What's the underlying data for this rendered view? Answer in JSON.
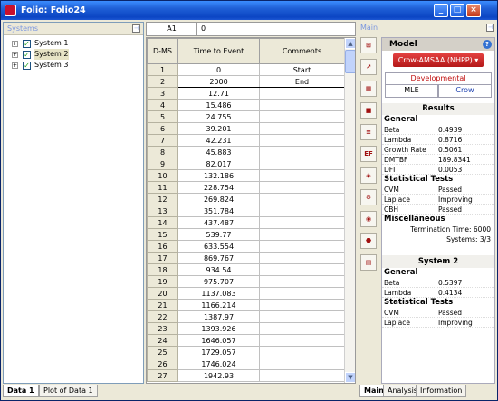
{
  "window": {
    "title": "Folio: Folio24"
  },
  "systems_pane": {
    "header": "Systems",
    "items": [
      {
        "label": "System 1",
        "checked": true
      },
      {
        "label": "System 2",
        "checked": true,
        "selected": true
      },
      {
        "label": "System 3",
        "checked": true
      }
    ]
  },
  "cell_bar": {
    "ref": "A1",
    "value": "0"
  },
  "grid": {
    "row_header_label": "D-MS",
    "columns": [
      "Time to Event",
      "Comments"
    ],
    "rows": [
      {
        "n": "1",
        "time": "0",
        "comment": "Start"
      },
      {
        "n": "2",
        "time": "2000",
        "comment": "End"
      },
      {
        "n": "3",
        "time": "12.71",
        "comment": ""
      },
      {
        "n": "4",
        "time": "15.486",
        "comment": ""
      },
      {
        "n": "5",
        "time": "24.755",
        "comment": ""
      },
      {
        "n": "6",
        "time": "39.201",
        "comment": ""
      },
      {
        "n": "7",
        "time": "42.231",
        "comment": ""
      },
      {
        "n": "8",
        "time": "45.883",
        "comment": ""
      },
      {
        "n": "9",
        "time": "82.017",
        "comment": ""
      },
      {
        "n": "10",
        "time": "132.186",
        "comment": ""
      },
      {
        "n": "11",
        "time": "228.754",
        "comment": ""
      },
      {
        "n": "12",
        "time": "269.824",
        "comment": ""
      },
      {
        "n": "13",
        "time": "351.784",
        "comment": ""
      },
      {
        "n": "14",
        "time": "437.487",
        "comment": ""
      },
      {
        "n": "15",
        "time": "539.77",
        "comment": ""
      },
      {
        "n": "16",
        "time": "633.554",
        "comment": ""
      },
      {
        "n": "17",
        "time": "869.767",
        "comment": ""
      },
      {
        "n": "18",
        "time": "934.54",
        "comment": ""
      },
      {
        "n": "19",
        "time": "975.707",
        "comment": ""
      },
      {
        "n": "20",
        "time": "1137.083",
        "comment": ""
      },
      {
        "n": "21",
        "time": "1166.214",
        "comment": ""
      },
      {
        "n": "22",
        "time": "1387.97",
        "comment": ""
      },
      {
        "n": "23",
        "time": "1393.926",
        "comment": ""
      },
      {
        "n": "24",
        "time": "1646.057",
        "comment": ""
      },
      {
        "n": "25",
        "time": "1729.057",
        "comment": ""
      },
      {
        "n": "26",
        "time": "1746.024",
        "comment": ""
      },
      {
        "n": "27",
        "time": "1942.93",
        "comment": ""
      }
    ]
  },
  "main_pane": {
    "header": "Main",
    "model_title": "Model",
    "model_button": "Crow-AMSAA (NHPP)",
    "dev_label": "Developmental",
    "method_left": "MLE",
    "method_right": "Crow",
    "results_title": "Results",
    "general_title": "General",
    "general": [
      {
        "k": "Beta",
        "v": "0.4939"
      },
      {
        "k": "Lambda",
        "v": "0.8716"
      },
      {
        "k": "Growth Rate",
        "v": "0.5061"
      },
      {
        "k": "DMTBF",
        "v": "189.8341"
      },
      {
        "k": "DFI",
        "v": "0.0053"
      }
    ],
    "stat_title": "Statistical Tests",
    "stats": [
      {
        "k": "CVM",
        "v": "Passed"
      },
      {
        "k": "Laplace",
        "v": "Improving"
      },
      {
        "k": "CBH",
        "v": "Passed"
      }
    ],
    "misc_title": "Miscellaneous",
    "termination": "Termination Time: 6000",
    "systems_count": "Systems: 3/3",
    "sys2_title": "System 2",
    "sys2_general_title": "General",
    "sys2_general": [
      {
        "k": "Beta",
        "v": "0.5397"
      },
      {
        "k": "Lambda",
        "v": "0.4134"
      }
    ],
    "sys2_stat_title": "Statistical Tests",
    "sys2_stats": [
      {
        "k": "CVM",
        "v": "Passed"
      },
      {
        "k": "Laplace",
        "v": "Improving"
      }
    ]
  },
  "tools": [
    "tool-a",
    "tool-b",
    "tool-c",
    "tool-d",
    "tool-e",
    "tool-f",
    "tool-g",
    "tool-h",
    "tool-i",
    "tool-j",
    "tool-k"
  ],
  "tool_labels": [
    "⊞",
    "↗",
    "▦",
    "■",
    "≡",
    "EF",
    "◈",
    "⚙",
    "◉",
    "⬣",
    "▤"
  ],
  "bottom_tabs": {
    "data1": "Data 1",
    "plot": "Plot of Data 1",
    "main": "Main",
    "analysis": "Analysis",
    "information": "Information"
  }
}
